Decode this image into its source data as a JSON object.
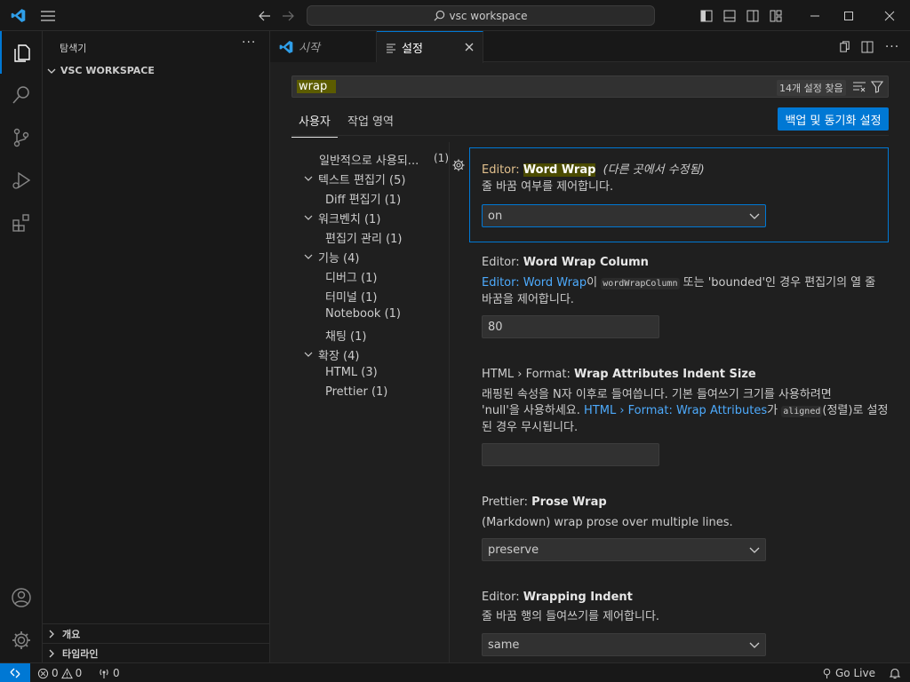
{
  "titlebar": {
    "search_text": "vsc workspace"
  },
  "sidebar": {
    "title": "탐색기",
    "more": "···",
    "workspace": "VSC WORKSPACE",
    "outline": "개요",
    "timeline": "타임라인"
  },
  "tabs": {
    "start": "시작",
    "settings": "설정"
  },
  "settings": {
    "search_value": "wrap",
    "result_count": "14개 설정 찾음",
    "scope_user": "사용자",
    "scope_workspace": "작업 영역",
    "sync_button": "백업 및 동기화 설정"
  },
  "toc": [
    {
      "label": "일반적으로 사용되...",
      "count": "(1)"
    },
    {
      "label": "텍스트 편집기 (5)"
    },
    {
      "label": "Diff 편집기 (1)"
    },
    {
      "label": "워크벤치 (1)"
    },
    {
      "label": "편집기 관리 (1)"
    },
    {
      "label": "기능 (4)"
    },
    {
      "label": "디버그 (1)"
    },
    {
      "label": "터미널 (1)"
    },
    {
      "label": "Notebook (1)"
    },
    {
      "label": "채팅 (1)"
    },
    {
      "label": "확장 (4)"
    },
    {
      "label": "HTML (3)"
    },
    {
      "label": "Prettier (1)"
    }
  ],
  "items": {
    "word_wrap": {
      "category": "Editor: ",
      "name": "Word Wrap",
      "modified": "(다른 곳에서 수정됨)",
      "description": "줄 바꿈 여부를 제어합니다.",
      "value": "on"
    },
    "word_wrap_column": {
      "category": "Editor: ",
      "name": "Word Wrap Column",
      "desc_link": "Editor: Word Wrap",
      "desc_part1": "이 ",
      "desc_code": "wordWrapColumn",
      "desc_part2": " 또는 'bounded'인 경우 편집기의 열 줄",
      "desc_line2": "바꿈을 제어합니다.",
      "value": "80"
    },
    "wrap_attr_indent": {
      "category": "HTML › Format: ",
      "name": "Wrap Attributes Indent Size",
      "desc_line1": "래핑된 속성을 N자 이후로 들여씁니다. 기본 들여쓰기 크기를 사용하려면",
      "desc_part1": "'null'을 사용하세요. ",
      "desc_link": "HTML › Format: Wrap Attributes",
      "desc_part2": "가 ",
      "desc_code": "aligned",
      "desc_part3": "(정렬)로 설정",
      "desc_line3": "된 경우 무시됩니다.",
      "value": ""
    },
    "prose_wrap": {
      "category": "Prettier: ",
      "name": "Prose Wrap",
      "description": "(Markdown) wrap prose over multiple lines.",
      "value": "preserve"
    },
    "wrapping_indent": {
      "category": "Editor: ",
      "name": "Wrapping Indent",
      "description": "줄 바꿈 행의 들여쓰기를 제어합니다.",
      "value": "same"
    }
  },
  "statusbar": {
    "errors": "0",
    "warnings": "0",
    "ports": "0",
    "go_live": "Go Live"
  }
}
